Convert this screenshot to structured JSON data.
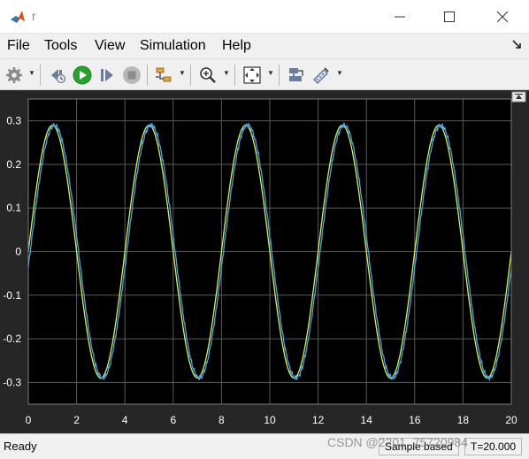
{
  "window": {
    "title": "r"
  },
  "menu": [
    "File",
    "Tools",
    "View",
    "Simulation",
    "Help"
  ],
  "toolbar": {
    "buttons": [
      "settings-icon",
      "step-back-icon",
      "run-icon",
      "step-forward-icon",
      "stop-icon",
      "signal-select-icon",
      "zoom-icon",
      "autoscale-icon",
      "highlight-block-icon",
      "measure-icon"
    ]
  },
  "colors": {
    "plot_bg": "#000000",
    "figure_bg": "#262626",
    "grid": "#5a5a5a",
    "signal_1": "#d6ef6b",
    "signal_2": "#4ea6dc",
    "tick_text": "#ffffff"
  },
  "chart_data": {
    "type": "line",
    "title": "",
    "xlabel": "",
    "ylabel": "",
    "xlim": [
      0,
      20
    ],
    "ylim": [
      -0.35,
      0.35
    ],
    "xticks": [
      0,
      2,
      4,
      6,
      8,
      10,
      12,
      14,
      16,
      18,
      20
    ],
    "yticks": [
      0.3,
      0.2,
      0.1,
      0,
      -0.1,
      -0.2,
      -0.3
    ],
    "yticklabels": [
      "0.3",
      "0.2",
      "0.1",
      "0",
      "-0.1",
      "-0.2",
      "-0.3"
    ],
    "grid": true,
    "legend": "none",
    "series": [
      {
        "color": "#d6ef6b",
        "amplitude": 0.29,
        "period": 4,
        "phase_x": 0,
        "x_range": [
          0,
          20
        ]
      },
      {
        "color": "#4ea6dc",
        "amplitude": 0.29,
        "period": 4,
        "phase_x": 0.08,
        "x_range": [
          0,
          20
        ],
        "noise": 0.006
      }
    ]
  },
  "status": {
    "ready": "Ready",
    "mode": "Sample based",
    "time": "T=20.000"
  },
  "watermark": "CSDN @2201_75720984"
}
